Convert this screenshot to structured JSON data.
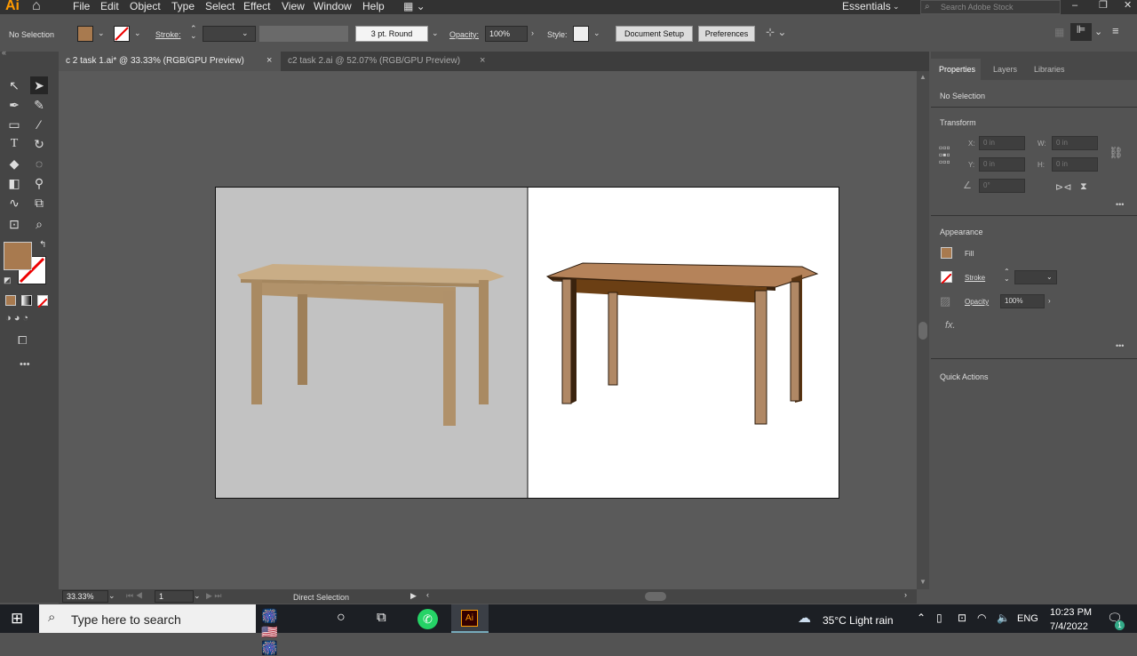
{
  "app": {
    "logo": "Ai"
  },
  "menu": [
    "File",
    "Edit",
    "Object",
    "Type",
    "Select",
    "Effect",
    "View",
    "Window",
    "Help"
  ],
  "workspace": {
    "name": "Essentials",
    "search_placeholder": "Search Adobe Stock"
  },
  "control": {
    "selection": "No Selection",
    "stroke_label": "Stroke:",
    "brush": "3 pt. Round",
    "opacity_label": "Opacity:",
    "opacity_value": "100%",
    "style_label": "Style:",
    "doc_setup": "Document Setup",
    "preferences": "Preferences",
    "fill_color": "#a87a4f"
  },
  "tabs": [
    {
      "label": "c 2 task 1.ai* @ 33.33% (RGB/GPU Preview)",
      "close": "×",
      "active": true
    },
    {
      "label": "c2 task 2.ai @ 52.07% (RGB/GPU Preview)",
      "close": "×",
      "active": false
    }
  ],
  "status": {
    "zoom": "33.33%",
    "page": "1",
    "tool": "Direct Selection"
  },
  "panel": {
    "tabs": [
      "Properties",
      "Layers",
      "Libraries"
    ],
    "selection": "No Selection",
    "transform": {
      "title": "Transform",
      "x_label": "X:",
      "x": "0 in",
      "y_label": "Y:",
      "y": "0 in",
      "w_label": "W:",
      "w": "0 in",
      "h_label": "H:",
      "h": "0 in",
      "angle": "0°"
    },
    "appearance": {
      "title": "Appearance",
      "fill": "Fill",
      "stroke": "Stroke",
      "opacity_label": "Opacity",
      "opacity": "100%",
      "fx": "fx."
    },
    "quick_actions": "Quick Actions",
    "more": "•••"
  },
  "taskbar": {
    "search": "Type here to search",
    "weather": "35°C  Light rain",
    "lang": "ENG",
    "time": "10:23 PM",
    "date": "7/4/2022",
    "notif": "1"
  }
}
